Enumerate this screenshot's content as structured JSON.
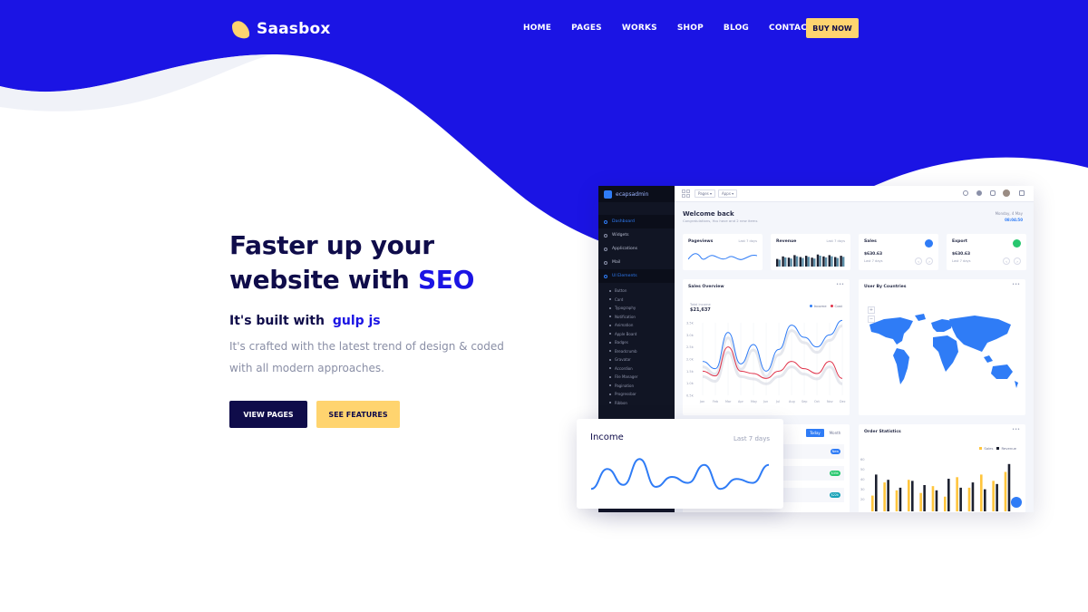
{
  "brand": {
    "name": "Saasbox",
    "primary": "#1b14e4",
    "accent": "#ffd46f",
    "dark": "#0f0c4a"
  },
  "nav": {
    "items": [
      "HOME",
      "PAGES",
      "WORKS",
      "SHOP",
      "BLOG",
      "CONTACT"
    ],
    "cta": "BUY NOW"
  },
  "hero": {
    "title_line1": "Faster up your",
    "title_line2": "website with",
    "title_highlight": "SEO",
    "sub_prefix": "It's built with",
    "sub_highlight": "gulp js",
    "description": "It's crafted with the latest trend of design & coded with all modern approaches.",
    "btn_primary": "VIEW PAGES",
    "btn_secondary": "SEE FEATURES"
  },
  "dashboard": {
    "logo": "ecapsadmin",
    "topbar_pills": [
      "Pages ▾",
      "Apps ▾"
    ],
    "sidebar": {
      "items": [
        {
          "label": "Dashboard",
          "active": true
        },
        {
          "label": "Widgets",
          "active": false
        },
        {
          "label": "Applications",
          "active": false
        },
        {
          "label": "Mail",
          "active": false
        },
        {
          "label": "UI Elements",
          "active": true
        }
      ],
      "sub_items": [
        "Button",
        "Card",
        "Typography",
        "Notification",
        "Animation",
        "Apple Board",
        "Badges",
        "Breadcrumb",
        "Gravatar",
        "Accordion",
        "File Manager",
        "Pagination",
        "Progressbar",
        "Ribbon"
      ]
    },
    "welcome": "Welcome back",
    "welcome_sub": "Congratulations, You have and 2 new items",
    "date_label": "Monday, 4 May",
    "date_value": "08:04:50",
    "cards": {
      "pageviews": {
        "title": "Pageviews",
        "meta": "Last 7 days"
      },
      "revenue": {
        "title": "Revenue",
        "meta": "Last 7 days"
      },
      "sales": {
        "title": "Sales",
        "value": "$630.63",
        "sub": "Last 7 days",
        "color": "#2f7cf6"
      },
      "export": {
        "title": "Export",
        "value": "$630.63",
        "sub": "Last 7 days",
        "color": "#28c76f"
      }
    },
    "sales_overview": {
      "title": "Sales Overview",
      "meta": "•••",
      "total_label": "Total income",
      "total_value": "$21,637",
      "legend": [
        "Income",
        "Cost"
      ]
    },
    "user_countries": {
      "title": "User By Countries",
      "meta": "•••"
    },
    "tabs": [
      "Today",
      "Month"
    ],
    "badges": [
      "New",
      "$35k",
      "$22k"
    ],
    "order_stats": {
      "title": "Order Statistics",
      "meta": "•••",
      "legend": [
        "Sales",
        "Revenue"
      ]
    }
  },
  "income": {
    "title": "Income",
    "meta": "Last 7 days"
  },
  "chart_data": [
    {
      "type": "line",
      "title": "Sales Overview",
      "categories": [
        "Jan",
        "Feb",
        "Mar",
        "Apr",
        "May",
        "Jun",
        "Jul",
        "Aug",
        "Sep",
        "Oct",
        "Nov",
        "Dec"
      ],
      "series": [
        {
          "name": "Income",
          "values": [
            1.9,
            1.6,
            3.1,
            1.8,
            2.6,
            1.5,
            2.4,
            3.4,
            2.9,
            2.5,
            3.0,
            3.6
          ]
        },
        {
          "name": "Cost",
          "values": [
            1.5,
            1.3,
            2.5,
            1.5,
            1.4,
            1.2,
            1.5,
            1.9,
            1.6,
            1.4,
            1.9,
            1.2
          ]
        }
      ],
      "y_ticks": [
        "3.5k",
        "3.0k",
        "2.5k",
        "2.0k",
        "1.5k",
        "1.0k",
        "0.5k"
      ]
    },
    {
      "type": "line",
      "title": "Income",
      "values": [
        0.2,
        0.7,
        0.3,
        0.95,
        0.25,
        0.5,
        0.35,
        0.8,
        0.2,
        0.45,
        0.35,
        0.8
      ]
    },
    {
      "type": "bar",
      "title": "Order Statistics",
      "series": [
        {
          "name": "Sales",
          "values": [
            30,
            55,
            40,
            60,
            35,
            48,
            28,
            65,
            45,
            70,
            58,
            75
          ]
        },
        {
          "name": "Revenue",
          "values": [
            70,
            60,
            45,
            58,
            50,
            40,
            62,
            45,
            55,
            42,
            52,
            90
          ]
        }
      ],
      "y_ticks": [
        "60",
        "50",
        "40",
        "30",
        "20"
      ]
    }
  ]
}
